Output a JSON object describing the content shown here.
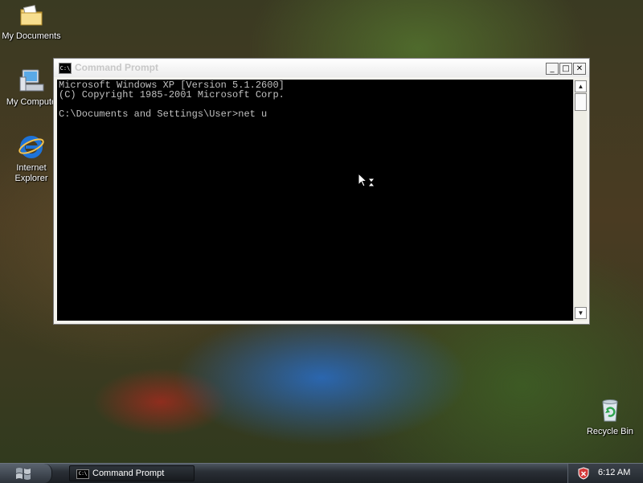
{
  "desktop": {
    "icons": [
      {
        "name": "my-documents",
        "label": "My Documents"
      },
      {
        "name": "my-computer",
        "label": "My Compute"
      },
      {
        "name": "internet-explorer",
        "label": "Internet\nExplorer"
      },
      {
        "name": "recycle-bin",
        "label": "Recycle Bin"
      }
    ]
  },
  "window": {
    "title": "Command Prompt",
    "icon_text": "C:\\",
    "console_lines": [
      "Microsoft Windows XP [Version 5.1.2600]",
      "(C) Copyright 1985-2001 Microsoft Corp.",
      "",
      "C:\\Documents and Settings\\User>net u"
    ],
    "buttons": {
      "minimize": "_",
      "maximize": "□",
      "close": "✕"
    }
  },
  "taskbar": {
    "task_label": "Command Prompt",
    "task_icon_text": "C:\\",
    "clock": "6:12 AM"
  },
  "colors": {
    "console_text": "#c0c0c0",
    "console_bg": "#000000",
    "title_text": "#c8c8c8"
  }
}
